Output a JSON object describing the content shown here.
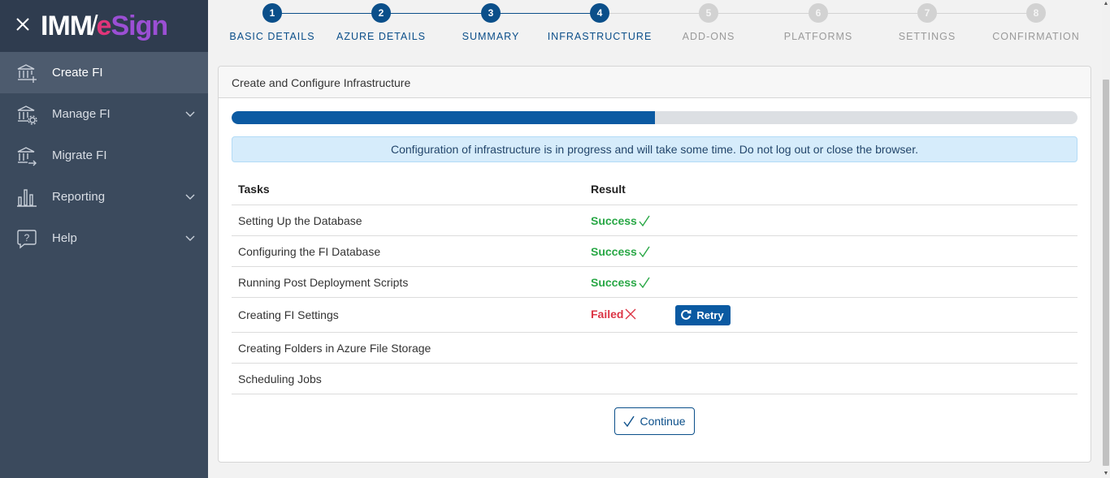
{
  "brand": {
    "part1": "IMM",
    "part2": "e",
    "part3": "Sign"
  },
  "sidebar": {
    "items": [
      {
        "label": "Create FI",
        "icon": "bank-add-icon",
        "active": true
      },
      {
        "label": "Manage FI",
        "icon": "bank-settings-icon",
        "expandable": true
      },
      {
        "label": "Migrate FI",
        "icon": "bank-arrow-icon"
      },
      {
        "label": "Reporting",
        "icon": "bar-chart-icon",
        "expandable": true
      },
      {
        "label": "Help",
        "icon": "help-icon",
        "expandable": true
      }
    ]
  },
  "stepper": {
    "steps": [
      {
        "number": "1",
        "label": "BASIC DETAILS",
        "state": "done"
      },
      {
        "number": "2",
        "label": "AZURE DETAILS",
        "state": "done"
      },
      {
        "number": "3",
        "label": "SUMMARY",
        "state": "done"
      },
      {
        "number": "4",
        "label": "INFRASTRUCTURE",
        "state": "done"
      },
      {
        "number": "5",
        "label": "ADD-ONS",
        "state": "todo"
      },
      {
        "number": "6",
        "label": "PLATFORMS",
        "state": "todo"
      },
      {
        "number": "7",
        "label": "SETTINGS",
        "state": "todo"
      },
      {
        "number": "8",
        "label": "CONFIRMATION",
        "state": "todo"
      }
    ]
  },
  "card": {
    "title": "Create and Configure Infrastructure",
    "progress_fraction": 0.5,
    "alert": "Configuration of infrastructure is in progress and will take some time. Do not log out or close the browser.",
    "table": {
      "headers": [
        "Tasks",
        "Result"
      ],
      "rows": [
        {
          "task": "Setting Up the Database",
          "result": "Success",
          "status": "success"
        },
        {
          "task": "Configuring the FI Database",
          "result": "Success",
          "status": "success"
        },
        {
          "task": "Running Post Deployment Scripts",
          "result": "Success",
          "status": "success"
        },
        {
          "task": "Creating FI Settings",
          "result": "Failed",
          "status": "failed",
          "action": "Retry"
        },
        {
          "task": "Creating Folders in Azure File Storage",
          "result": "",
          "status": "pending"
        },
        {
          "task": "Scheduling Jobs",
          "result": "",
          "status": "pending"
        }
      ]
    },
    "continue_label": "Continue"
  },
  "colors": {
    "sidebar_bg": "#3b4a5d",
    "primary": "#0b5aa2",
    "success": "#28a745",
    "danger": "#dc3545",
    "muted": "#9a9a9a"
  }
}
